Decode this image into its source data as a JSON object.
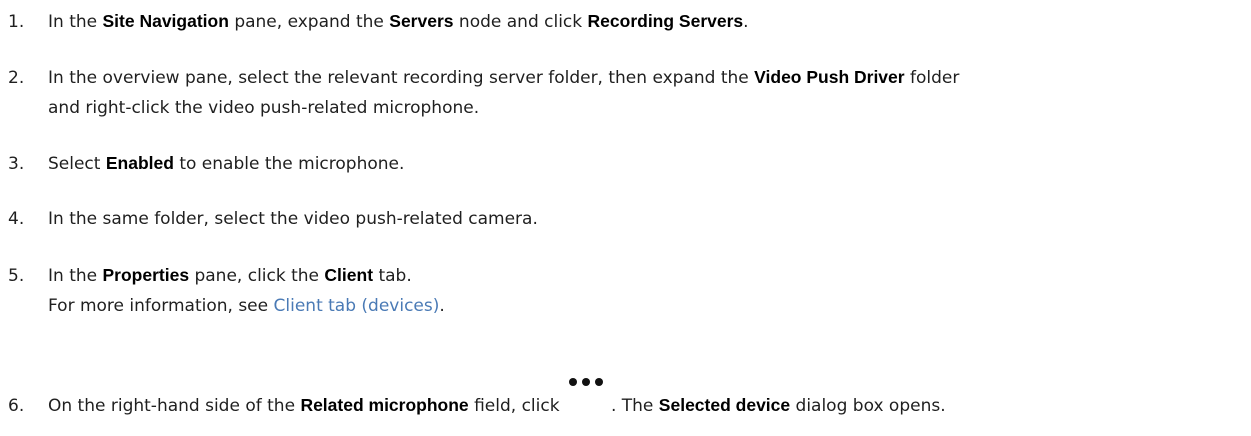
{
  "steps": [
    {
      "num": "1.",
      "t1": "In the ",
      "b1": "Site Navigation",
      "t2": " pane, expand the ",
      "b2": "Servers",
      "t3": " node and click ",
      "b3": "Recording Servers",
      "t4": "."
    },
    {
      "num": "2.",
      "t1": "In the overview pane, select the relevant recording server folder, then expand the ",
      "b1": "Video Push Driver",
      "t2": " folder",
      "line2": "and right-click the video push-related microphone."
    },
    {
      "num": "3.",
      "t1": "Select ",
      "b1": "Enabled",
      "t2": " to enable the microphone."
    },
    {
      "num": "4.",
      "t1": "In the same folder, select the video push-related camera."
    },
    {
      "num": "5.",
      "t1": "In the ",
      "b1": "Properties",
      "t2": " pane, click the ",
      "b2": "Client",
      "t3": " tab.",
      "line2_pre": "For more information, see ",
      "link": "Client tab (devices)",
      "line2_post": "."
    },
    {
      "num": "6.",
      "t1": "On the right-hand side of the ",
      "b1": "Related microphone",
      "t2": " field, click ",
      "icon": "more-options-ellipsis-icon",
      "t3": ". The ",
      "b2": "Selected device",
      "t4": " dialog box opens."
    }
  ],
  "colors": {
    "text": "#1f1f1f",
    "bold": "#000000",
    "link": "#4a7ab5"
  }
}
